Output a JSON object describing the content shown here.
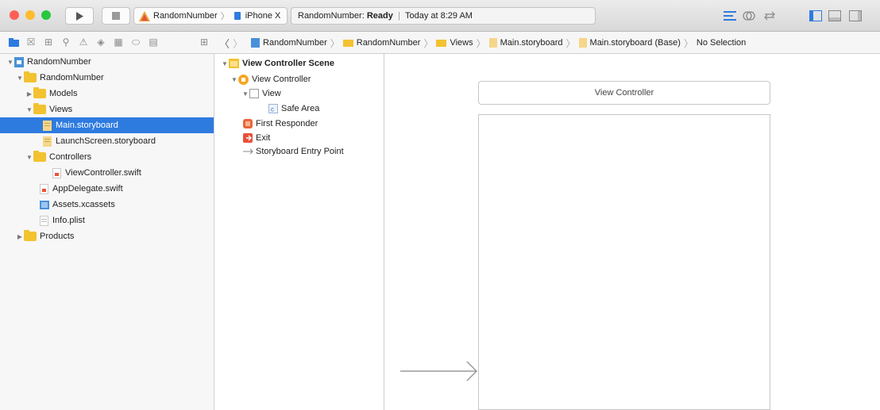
{
  "toolbar": {
    "scheme_project": "RandomNumber",
    "scheme_device": "iPhone X",
    "activity_project": "RandomNumber:",
    "activity_status": "Ready",
    "activity_separator": "|",
    "activity_time": "Today at 8:29 AM",
    "colors": {
      "close": "#fe5f57",
      "minimize": "#febc2e",
      "zoom": "#28c840",
      "accent": "#2e7be0"
    }
  },
  "jumpbar": {
    "items": [
      "RandomNumber",
      "RandomNumber",
      "Views",
      "Main.storyboard",
      "Main.storyboard (Base)",
      "No Selection"
    ]
  },
  "navigator": {
    "items": [
      {
        "label": "RandomNumber",
        "icon": "project-icon"
      },
      {
        "label": "RandomNumber",
        "icon": "folder-icon"
      },
      {
        "label": "Models",
        "icon": "folder-icon"
      },
      {
        "label": "Views",
        "icon": "folder-icon"
      },
      {
        "label": "Main.storyboard",
        "icon": "storyboard-file-icon"
      },
      {
        "label": "LaunchScreen.storyboard",
        "icon": "storyboard-file-icon"
      },
      {
        "label": "Controllers",
        "icon": "folder-icon"
      },
      {
        "label": "ViewController.swift",
        "icon": "swift-file-icon"
      },
      {
        "label": "AppDelegate.swift",
        "icon": "swift-file-icon"
      },
      {
        "label": "Assets.xcassets",
        "icon": "assets-icon"
      },
      {
        "label": "Info.plist",
        "icon": "plist-icon"
      },
      {
        "label": "Products",
        "icon": "folder-icon"
      }
    ]
  },
  "outline": {
    "items": [
      {
        "label": "View Controller Scene",
        "icon": "scene-icon"
      },
      {
        "label": "View Controller",
        "icon": "view-controller-icon"
      },
      {
        "label": "View",
        "icon": "view-icon"
      },
      {
        "label": "Safe Area",
        "icon": "safe-area-icon"
      },
      {
        "label": "First Responder",
        "icon": "first-responder-icon"
      },
      {
        "label": "Exit",
        "icon": "exit-icon"
      },
      {
        "label": "Storyboard Entry Point",
        "icon": "entry-point-icon"
      }
    ],
    "safe_area_glyph": "c"
  },
  "canvas": {
    "title": "View Controller"
  }
}
